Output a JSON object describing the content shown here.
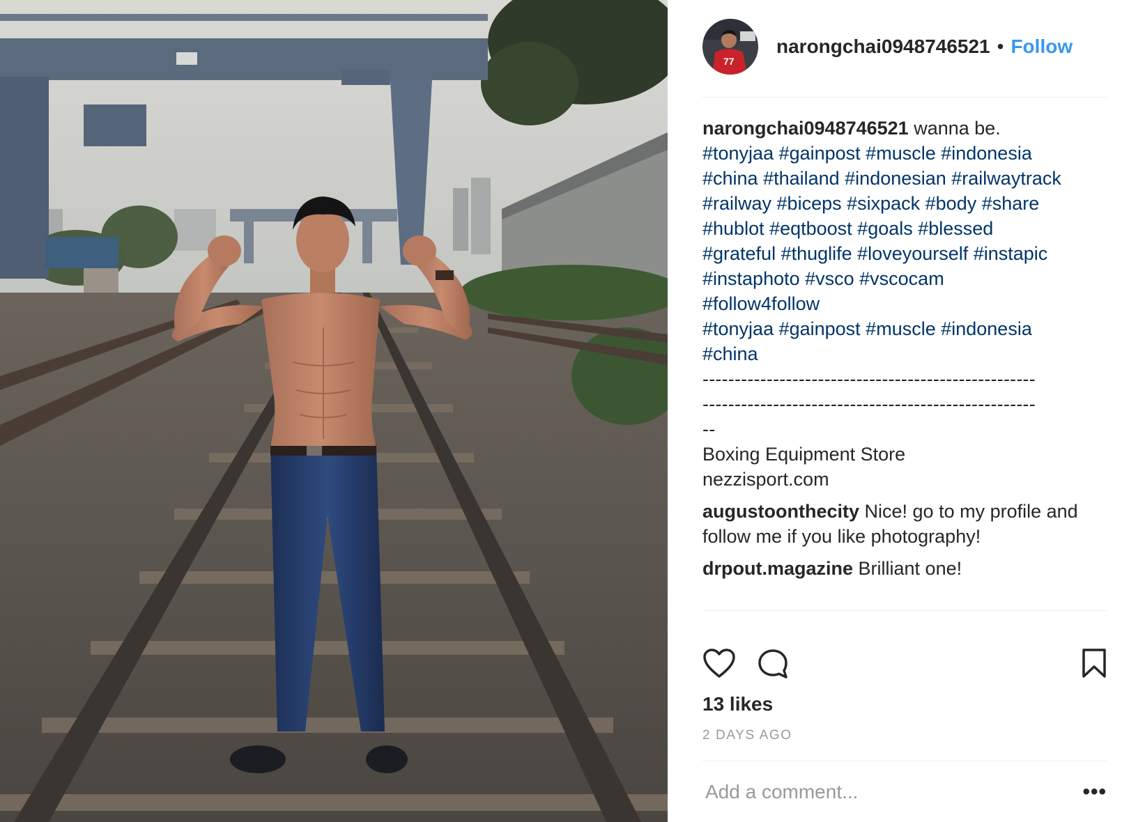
{
  "header": {
    "username": "narongchai0948746521",
    "separator": "•",
    "follow_label": "Follow"
  },
  "caption": {
    "username": "narongchai0948746521",
    "text": " wanna be.",
    "hashtag_lines": [
      "#tonyjaa #gainpost #muscle #indonesia",
      "#china #thailand #indonesian #railwaytrack",
      "#railway #biceps #sixpack #body #share",
      "#hublot #eqtboost #goals #blessed",
      "#grateful #thuglife #loveyourself #instapic",
      "#instaphoto #vsco #vscocam",
      "#follow4follow",
      "#tonyjaa #gainpost #muscle #indonesia",
      "#china"
    ],
    "dash_line_1": "----------------------------------------------------",
    "dash_line_2": "----------------------------------------------------",
    "dash_line_3": "--",
    "store_line": "Boxing Equipment Store",
    "url_line": "nezzisport.com"
  },
  "comments": [
    {
      "username": "augustoonthecity",
      "text": " Nice! go to my profile and follow me if you like photography!"
    },
    {
      "username": "drpout.magazine",
      "text": " Brilliant one!"
    }
  ],
  "actions": {
    "like_icon": "heart-outline-icon",
    "comment_icon": "speech-bubble-icon",
    "save_icon": "bookmark-outline-icon"
  },
  "likes_text": "13 likes",
  "timestamp": "2 DAYS AGO",
  "add_comment": {
    "placeholder": "Add a comment...",
    "more_label": "•••"
  },
  "colors": {
    "link_blue": "#3897f0",
    "hashtag": "#003569",
    "text": "#262626",
    "muted": "#999999",
    "divider": "#efefef"
  }
}
